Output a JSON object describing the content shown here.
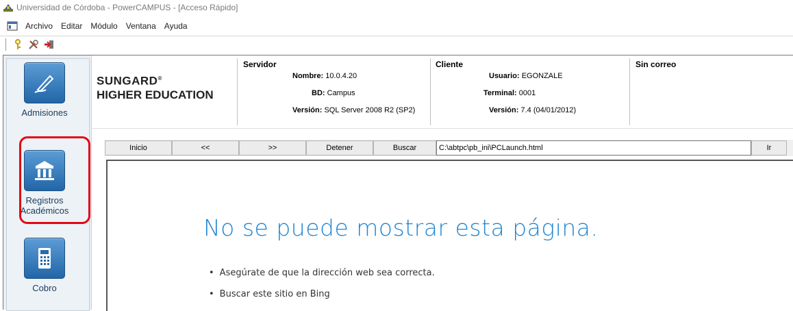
{
  "window": {
    "title": "Universidad de Córdoba - PowerCAMPUS - [Acceso Rápido]"
  },
  "menu": [
    "Archivo",
    "Editar",
    "Módulo",
    "Ventana",
    "Ayuda"
  ],
  "toolbar_icons": [
    "key-icon",
    "tools-icon",
    "exit-icon"
  ],
  "sidebar": {
    "items": [
      {
        "label": "Admisiones",
        "icon": "pen-icon"
      },
      {
        "label_line1": "Registros",
        "label_line2": "Académicos",
        "icon": "building-icon"
      },
      {
        "label": "Cobro",
        "icon": "calculator-icon"
      }
    ],
    "highlight_color": "#e30613"
  },
  "logo": {
    "line1": "SUNGARD",
    "line2": "HIGHER EDUCATION"
  },
  "server": {
    "heading": "Servidor",
    "name_label": "Nombre:",
    "name_value": "10.0.4.20",
    "db_label": "BD:",
    "db_value": "Campus",
    "version_label": "Versión:",
    "version_value": "SQL Server 2008 R2 (SP2)"
  },
  "client": {
    "heading": "Cliente",
    "user_label": "Usuario:",
    "user_value": "EGONZALE",
    "terminal_label": "Terminal:",
    "terminal_value": "0001",
    "version_label": "Versión:",
    "version_value": "7.4 (04/01/2012)"
  },
  "mail": {
    "heading": "Sin correo"
  },
  "nav": {
    "home": "Inicio",
    "back": "<<",
    "forward": ">>",
    "stop": "Detener",
    "search": "Buscar",
    "url": "C:\\abtpc\\pb_ini\\PCLaunch.html",
    "go": "Ir"
  },
  "error_page": {
    "title": "No se puede mostrar esta página.",
    "items": [
      "Asegúrate de que la dirección web sea correcta.",
      "Buscar este sitio en Bing"
    ],
    "title_color": "#1e85d2"
  }
}
